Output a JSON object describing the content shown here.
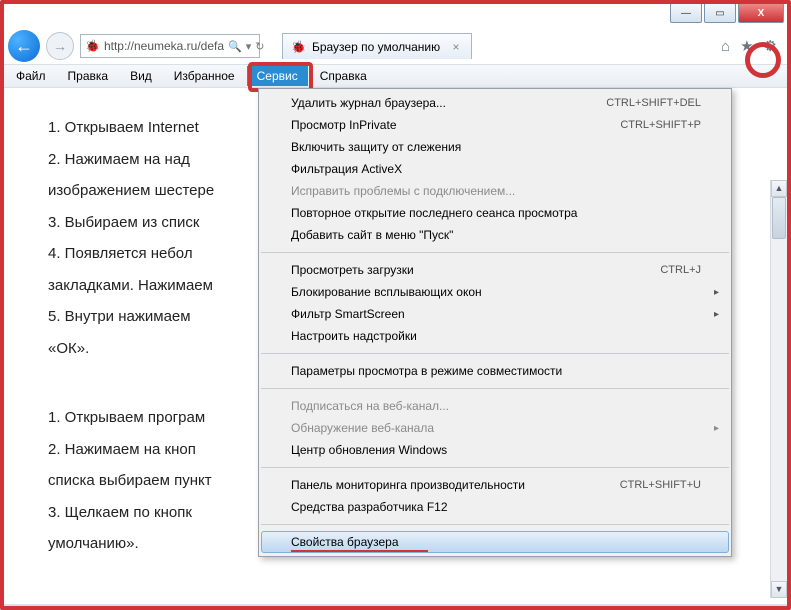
{
  "window": {
    "minimize": "—",
    "maximize": "▭",
    "close": "X"
  },
  "nav": {
    "back": "←",
    "forward": "→",
    "url": "http://neumeka.ru/defa",
    "search_glyph": "🔍",
    "refresh_glyph": "↻",
    "dropdown_glyph": "▾"
  },
  "tab": {
    "title": "Браузер по умолчанию",
    "close": "×"
  },
  "right_icons": {
    "home": "⌂",
    "star": "★",
    "gear": "⚙"
  },
  "menubar": {
    "file": "Файл",
    "edit": "Правка",
    "view": "Вид",
    "favorites": "Избранное",
    "tools": "Сервис",
    "help": "Справка"
  },
  "page_text": {
    "l1": "1.   Открываем Internet",
    "l2": "2.  Нажимаем на над",
    "l2b": "изображением шестере",
    "l3": "3.   Выбираем из списк",
    "l4": "4.  Появляется  небол",
    "l4b": "закладками. Нажимаем",
    "l5": "5.  Внутри нажимаем",
    "l5b": "«ОК».",
    "s1": "1.   Открываем програм",
    "s2": "2.  Нажимаем на кноп",
    "s2b": "списка выбираем пункт",
    "s3": "3.  Щелкаем по кнопк",
    "s3b": "умолчанию»."
  },
  "dropdown": {
    "groups": [
      [
        {
          "label": "Удалить журнал браузера...",
          "shortcut": "CTRL+SHIFT+DEL"
        },
        {
          "label": "Просмотр InPrivate",
          "shortcut": "CTRL+SHIFT+P"
        },
        {
          "label": "Включить защиту от слежения"
        },
        {
          "label": "Фильтрация ActiveX"
        },
        {
          "label": "Исправить проблемы с подключением...",
          "disabled": true
        },
        {
          "label": "Повторное открытие последнего сеанса просмотра"
        },
        {
          "label": "Добавить сайт в меню \"Пуск\""
        }
      ],
      [
        {
          "label": "Просмотреть загрузки",
          "shortcut": "CTRL+J"
        },
        {
          "label": "Блокирование всплывающих окон",
          "submenu": true
        },
        {
          "label": "Фильтр SmartScreen",
          "submenu": true
        },
        {
          "label": "Настроить надстройки"
        }
      ],
      [
        {
          "label": "Параметры просмотра в режиме совместимости"
        }
      ],
      [
        {
          "label": "Подписаться на веб-канал...",
          "disabled": true
        },
        {
          "label": "Обнаружение веб-канала",
          "submenu": true,
          "disabled": true
        },
        {
          "label": "Центр обновления Windows"
        }
      ],
      [
        {
          "label": "Панель мониторинга производительности",
          "shortcut": "CTRL+SHIFT+U"
        },
        {
          "label": "Средства разработчика F12"
        }
      ],
      [
        {
          "label": "Свойства браузера",
          "hover": true,
          "underlined": true
        }
      ]
    ],
    "arrow_glyph": "▸"
  }
}
